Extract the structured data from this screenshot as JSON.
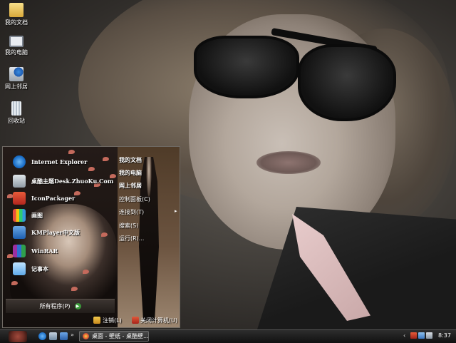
{
  "desktop_icons": [
    {
      "label": "我的文档",
      "icon": "folder-icon"
    },
    {
      "label": "我的电脑",
      "icon": "computer-icon"
    },
    {
      "label": "网上邻居",
      "icon": "network-icon"
    },
    {
      "label": "回收站",
      "icon": "recycle-bin-icon"
    }
  ],
  "start_menu": {
    "pinned": [
      {
        "label": "Internet Explorer",
        "icon": "internet-explorer-icon"
      },
      {
        "label": "桌酷主题Desk.ZhuoKu.Com",
        "icon": "theme-icon"
      },
      {
        "label": "IconPackager",
        "icon": "iconpackager-icon"
      },
      {
        "label": "画图",
        "icon": "paint-icon"
      },
      {
        "label": "KMPlayer中文版",
        "icon": "kmplayer-icon"
      },
      {
        "label": "WinRAR",
        "icon": "winrar-icon"
      },
      {
        "label": "记事本",
        "icon": "notepad-icon"
      }
    ],
    "all_programs": "所有程序(P)",
    "places": [
      {
        "label": "我的文档",
        "bold": true
      },
      {
        "label": "我的电脑",
        "bold": true
      },
      {
        "label": "网上邻居",
        "bold": true
      },
      {
        "label": "控制面板(C)",
        "bold": false
      },
      {
        "label": "连接到(T)",
        "bold": false
      },
      {
        "label": "搜索(S)",
        "bold": false
      },
      {
        "label": "运行(R)...",
        "bold": false
      }
    ],
    "logoff": "注销(L)",
    "shutdown": "关闭计算机(U)"
  },
  "taskbar": {
    "task_button": "桌面 - 壁纸 - 桌酷壁...",
    "clock": "8:37"
  }
}
